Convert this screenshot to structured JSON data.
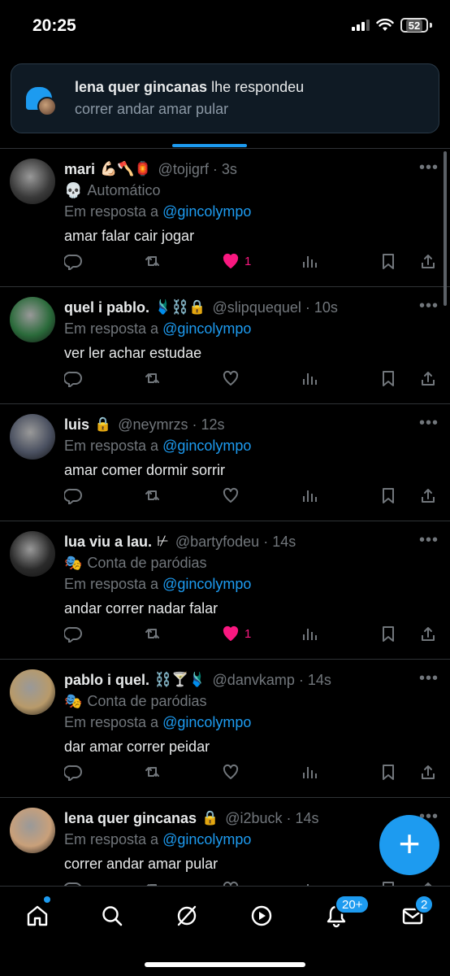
{
  "status_bar": {
    "time": "20:25",
    "battery": "52"
  },
  "notification": {
    "author": "lena quer gincanas",
    "action": " lhe respondeu",
    "text": "correr andar amar pular"
  },
  "tweets": [
    {
      "name": "mari",
      "emoji": "💪🏻🪓🏮",
      "handle": "@tojigrf · 3s",
      "meta_icon": "💀",
      "meta": "Automático",
      "reply_prefix": "Em resposta a ",
      "reply_to": "@gincolympo",
      "text": "amar falar cair jogar",
      "likes": "1",
      "liked": true,
      "avatar_color": "#3a3a3a"
    },
    {
      "name": "quel i pablo.",
      "emoji": "🩱⛓️🔒",
      "handle": "@slipquequel · 10s",
      "meta_icon": "",
      "meta": "",
      "reply_prefix": "Em resposta a ",
      "reply_to": "@gincolympo",
      "text": "ver ler achar estudae",
      "likes": "",
      "liked": false,
      "avatar_color": "#2a6a3a"
    },
    {
      "name": "luis",
      "emoji": "🔒",
      "handle": "@neymrzs · 12s",
      "meta_icon": "",
      "meta": "",
      "reply_prefix": "Em resposta a ",
      "reply_to": "@gincolympo",
      "text": "amar comer dormir sorrir",
      "likes": "",
      "liked": false,
      "avatar_color": "#4a5060"
    },
    {
      "name": "lua viu a lau.",
      "emoji": "⊬",
      "handle": "@bartyfodeu · 14s",
      "meta_icon": "🎭",
      "meta": "Conta de paródias",
      "reply_prefix": "Em resposta a ",
      "reply_to": "@gincolympo",
      "text": "andar correr nadar falar",
      "likes": "1",
      "liked": true,
      "avatar_color": "#2a2a2a"
    },
    {
      "name": "pablo i quel.",
      "emoji": "⛓️🍸🩱",
      "handle": "@danvkamp · 14s",
      "meta_icon": "🎭",
      "meta": "Conta de paródias",
      "reply_prefix": "Em resposta a ",
      "reply_to": "@gincolympo",
      "text": "dar amar correr peidar",
      "likes": "",
      "liked": false,
      "avatar_color": "#b89a6a"
    },
    {
      "name": "lena quer gincanas",
      "emoji": "🔒",
      "handle": "@i2buck · 14s",
      "meta_icon": "",
      "meta": "",
      "reply_prefix": "Em resposta a ",
      "reply_to": "@gincolympo",
      "text": "correr andar amar pular",
      "likes": "",
      "liked": false,
      "avatar_color": "#c9a07a"
    }
  ],
  "more_glyph": "•••",
  "fab_label": "+",
  "nav": {
    "notifications_badge": "20+",
    "messages_badge": "2"
  },
  "colors": {
    "accent": "#1d9bf0",
    "like": "#f91880",
    "muted": "#71767b"
  }
}
